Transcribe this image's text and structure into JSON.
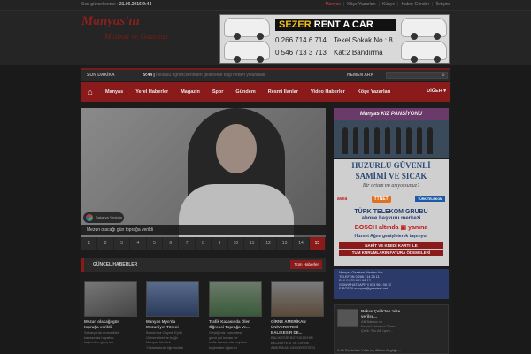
{
  "topbar": {
    "updated_label": "Son güncellenme :",
    "updated_value": "21.06.2016 9:44",
    "links": [
      "Manyas",
      "Köşe Yazarları",
      "Künye",
      "Haber Gönder",
      "İletişim"
    ]
  },
  "logo": {
    "line1": "Manyas'ın",
    "line2": "Matbaa ve Gazetesi"
  },
  "ad": {
    "brand1": "SEZER",
    "brand2": " RENT A CAR",
    "phone1": "0 266 714 6 714",
    "phone2": "0 546 713 3 713",
    "addr1": "Tekel Sokak No : 8",
    "addr2": "Kat:2  Bandırma"
  },
  "ticker": {
    "label": "SON DAKİKA",
    "time": "9:44 |",
    "text": " İlkokulu öğrencilerinden gelecekte bilgi hedefi yolundaki",
    "label2": "HEMEN ARA"
  },
  "nav": {
    "items": [
      "Manyas",
      "Yerel Haberler",
      "Magazin",
      "Spor",
      "Gündem",
      "Resmi İlanlar",
      "Video Haberler",
      "Köşe Yazarları"
    ],
    "more": "DİĞER"
  },
  "slider": {
    "caption": "Mezun olacağı gün toprağa verildi",
    "watermark": "Sakarya Yenigün",
    "pages": [
      "1",
      "2",
      "3",
      "4",
      "5",
      "6",
      "7",
      "8",
      "9",
      "10",
      "11",
      "12",
      "13",
      "14",
      "15"
    ],
    "active": 15
  },
  "news": {
    "title": "GÜNCEL HABERLER",
    "all_button": "Tüm Haberler",
    "cards": [
      {
        "title": "Mezun olacağı gün\ntoprağa verildi",
        "desc": "Sakarya'da motosiklet\nkazasında hayatını\nkaybeden genç kız"
      },
      {
        "title": "Manyas Myo'da\nMezuniyet Töreni",
        "desc": "Bandırma Onyedi Eylül\nÜniversitesi'ne bağlı\nManyas Meslek\nYüksekokulu öğrencileri"
      },
      {
        "title": "Trafik Kazasında Ölen\nÖğrenci Toprağa Ve...",
        "desc": "Geçtiğimiz cumartesi\ngünü yol kenarı ile\ntrafik kazasında hayatını\nkaybeden öğrenci"
      },
      {
        "title": "GİRNE AMERİKAN\nÜNİVERSİTESİ\nBALIKESİR DE...",
        "desc": "BALIKESİR BÜYÜKŞEHİR\nBELEDİYESİ VE GİRNE\nAMERİKAN ÜNİVERSİTESİ"
      }
    ]
  },
  "sidebar": {
    "ad2_title": "Manyas KIZ PANSİYONU",
    "ad3": {
      "h1": "HUZURLU GÜVENLİ",
      "h2": "SAMİMİ VE SICAK",
      "h3": "Bir ortam mı arıyorsunuz?",
      "logo1": "avea",
      "logo2": "TTNET",
      "logo3": "TÜRK TELEKOM",
      "tt": "TÜRK TELEKOM GRUBU",
      "tt2": "abone başvuru merkezi",
      "bosch": "BOSCH altında",
      "bosch2": "yanına",
      "move": "Hizmet Ağını genişleterek taşınıyor",
      "bar1": "NAKİT VE KREDİ KARTI İLE",
      "bar2": "TUM KURUMLARIN FATURA ÖDEMELERİ"
    },
    "contact": "Manyas Gazetesi Merkez Adr.\nTELEFON             0 266 714 25 11\nFAX                     0 533 961 98 12\nGSM/WHATSAPP  0 533 961 98 12\nE-POSTA              manyas@gazetesi.net",
    "side_news": {
      "title": "Bekan Çelik'ten 'vize\nverilse...",
      "sub": "AB Bakanı ve\nBaşmüzakereci Ömer\nÇelik \"Siz AB üyeli...",
      "more": "9:44  Soylu'dan Yıldırım, Bilmeni't göğe..."
    }
  },
  "colors": {
    "accent": "#8b1a1a",
    "background": "#1c1c1c"
  }
}
